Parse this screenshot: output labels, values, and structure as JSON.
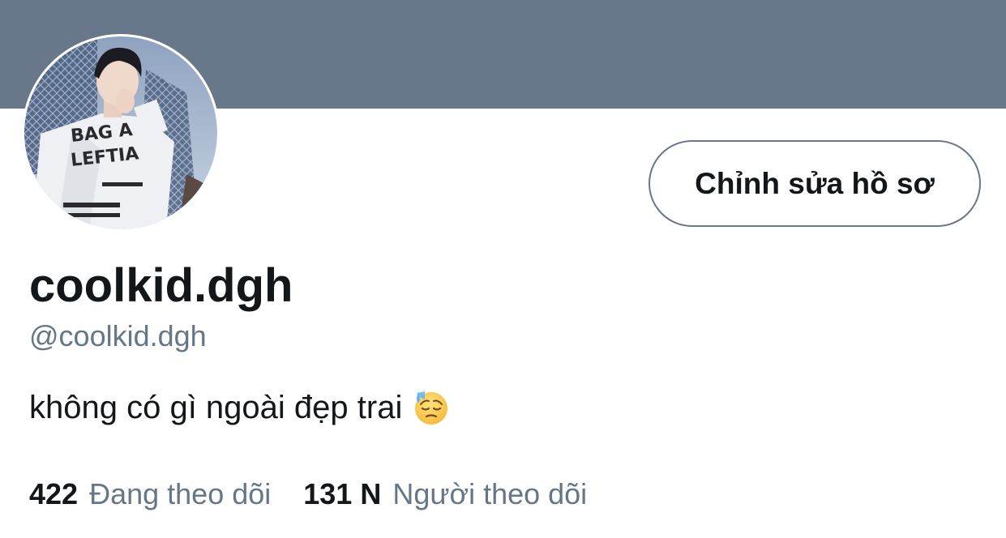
{
  "profile": {
    "display_name": "coolkid.dgh",
    "handle": "@coolkid.dgh",
    "bio": "không có gì ngoài đẹp trai",
    "bio_emoji": "downcast-face-with-sweat-icon",
    "edit_button_label": "Chỉnh sửa hồ sơ"
  },
  "stats": {
    "following_count": "422",
    "following_label": "Đang theo dõi",
    "followers_count": "131 N",
    "followers_label": "Người theo dõi"
  },
  "colors": {
    "banner": "#68778a",
    "text_primary": "#14171a",
    "text_secondary": "#657786",
    "button_border": "#68778a",
    "background": "#ffffff"
  }
}
